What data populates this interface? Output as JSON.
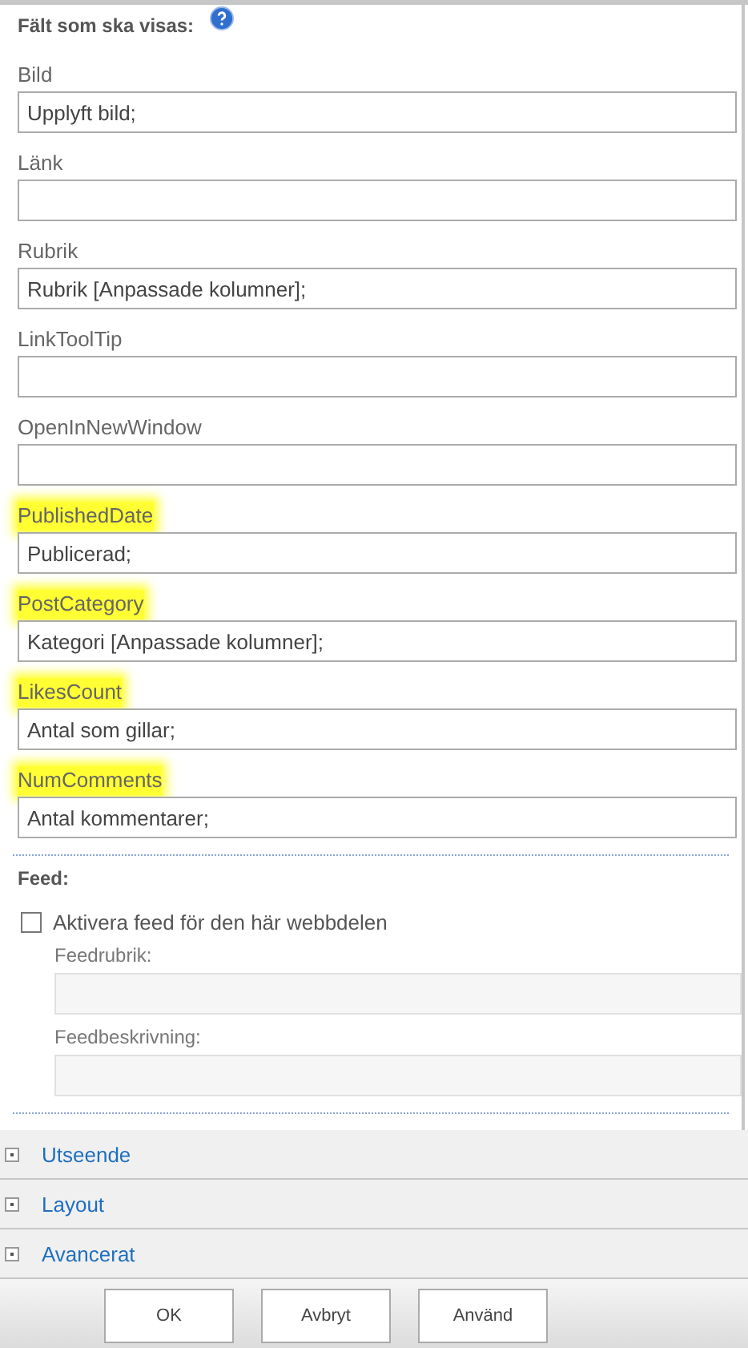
{
  "fields_section": {
    "title": "Fält som ska visas:",
    "fields": [
      {
        "label": "Bild",
        "value": "Upplyft bild;",
        "highlighted": false
      },
      {
        "label": "Länk",
        "highlighted": false
      },
      {
        "label": "Rubrik",
        "value": "Rubrik [Anpassade kolumner];",
        "highlighted": false
      },
      {
        "label": "LinkToolTip",
        "highlighted": false
      },
      {
        "label": "OpenInNewWindow",
        "highlighted": false
      },
      {
        "label": "PublishedDate",
        "value": "Publicerad;",
        "highlighted": true
      },
      {
        "label": "PostCategory",
        "value": "Kategori [Anpassade kolumner];",
        "highlighted": true
      },
      {
        "label": "LikesCount",
        "value": "Antal som gillar;",
        "highlighted": true
      },
      {
        "label": "NumComments",
        "value": "Antal kommentarer;",
        "highlighted": true
      }
    ]
  },
  "feed_section": {
    "title": "Feed:",
    "checkbox": {
      "label": "Aktivera feed för den här webbdelen",
      "checked": false
    },
    "fields": [
      {
        "label": "Feedrubrik:",
        "disabled": true
      },
      {
        "label": "Feedbeskrivning:",
        "disabled": true
      }
    ]
  },
  "collapsed_sections": [
    {
      "label": "Utseende",
      "expanded": false
    },
    {
      "label": "Layout",
      "expanded": false
    },
    {
      "label": "Avancerat",
      "expanded": false
    }
  ],
  "buttons": [
    "OK",
    "Avbryt",
    "Använd"
  ]
}
